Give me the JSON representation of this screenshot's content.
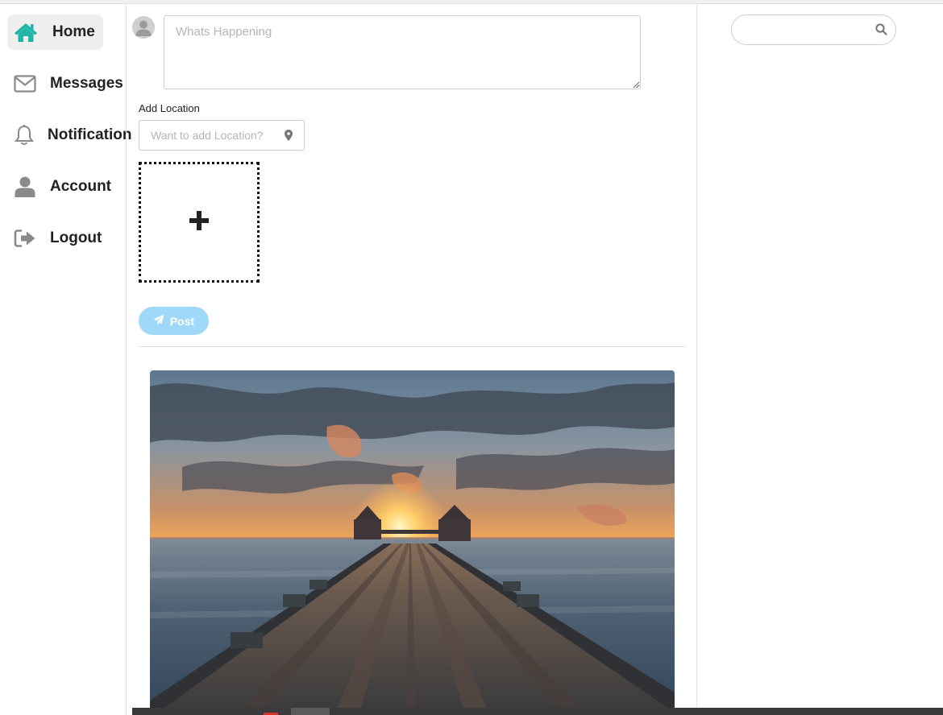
{
  "sidebar": {
    "items": [
      {
        "label": "Home",
        "icon": "home-icon",
        "active": true
      },
      {
        "label": "Messages",
        "icon": "envelope-icon",
        "active": false
      },
      {
        "label": "Notification",
        "icon": "bell-icon",
        "active": false
      },
      {
        "label": "Account",
        "icon": "user-icon",
        "active": false
      },
      {
        "label": "Logout",
        "icon": "sign-out-icon",
        "active": false
      }
    ]
  },
  "composer": {
    "placeholder": "Whats Happening",
    "location_label": "Add Location",
    "location_placeholder": "Want to add Location?",
    "post_label": "Post"
  },
  "search": {
    "placeholder": ""
  },
  "colors": {
    "accent": "#1fb5a8",
    "post_button": "#9fd8f8",
    "active_bg": "#efefef",
    "icon_grey": "#8a8a8a"
  }
}
